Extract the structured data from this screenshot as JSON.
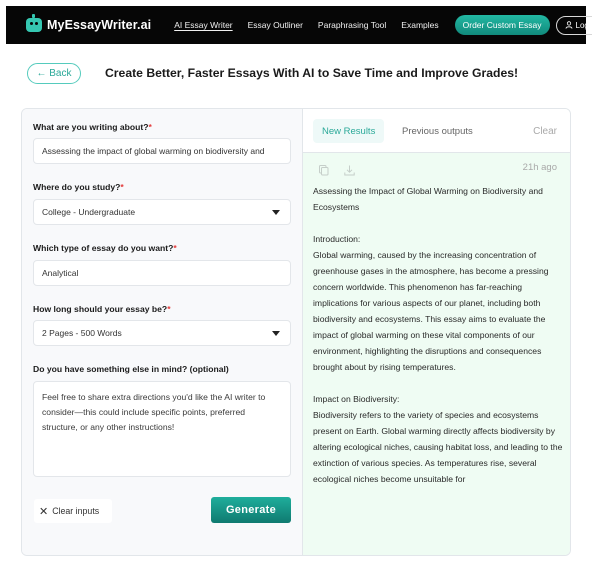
{
  "navbar": {
    "brand": "MyEssayWriter.ai",
    "links": [
      "AI Essay Writer",
      "Essay Outliner",
      "Paraphrasing Tool",
      "Examples"
    ],
    "active_link": "AI Essay Writer",
    "order_button": "Order Custom Essay",
    "login_button": "Login",
    "accent_color": "#1aa494"
  },
  "header": {
    "back_button": "← Back",
    "title": "Create Better, Faster Essays With AI to Save Time and Improve Grades!"
  },
  "form": {
    "topic": {
      "label": "What are you writing about?",
      "required_mark": "*",
      "value": "Assessing the impact of global warming on biodiversity and"
    },
    "study_level": {
      "label": "Where do you study?",
      "required_mark": "*",
      "selected": "College - Undergraduate"
    },
    "essay_type": {
      "label": "Which type of essay do you want?",
      "required_mark": "*",
      "value": "Analytical"
    },
    "length": {
      "label": "How long should your essay be?",
      "required_mark": "*",
      "selected": "2 Pages - 500 Words"
    },
    "extra": {
      "label": "Do you have something else in mind? (optional)",
      "placeholder": "Feel free to share extra directions you'd like the AI writer to consider—this could include specific points, preferred structure, or any other instructions!"
    },
    "clear_button": "Clear inputs",
    "generate_button": "Generate"
  },
  "results": {
    "tabs": [
      "New Results",
      "Previous outputs"
    ],
    "active_tab": "New Results",
    "clear_button": "Clear",
    "icons": [
      "copy-icon",
      "download-icon"
    ],
    "timestamp": "21h ago",
    "paragraphs": [
      "Assessing the Impact of Global Warming on Biodiversity and Ecosystems",
      "Introduction:\nGlobal warming, caused by the increasing concentration of greenhouse gases in the atmosphere, has become a pressing concern worldwide. This phenomenon has far-reaching implications for various aspects of our planet, including both biodiversity and ecosystems. This essay aims to evaluate the impact of global warming on these vital components of our environment, highlighting the disruptions and consequences brought about by rising temperatures.",
      "Impact on Biodiversity:\nBiodiversity refers to the variety of species and ecosystems present on Earth. Global warming directly affects biodiversity by altering ecological niches, causing habitat loss, and leading to the extinction of various species. As temperatures rise, several ecological niches become unsuitable for"
    ]
  }
}
